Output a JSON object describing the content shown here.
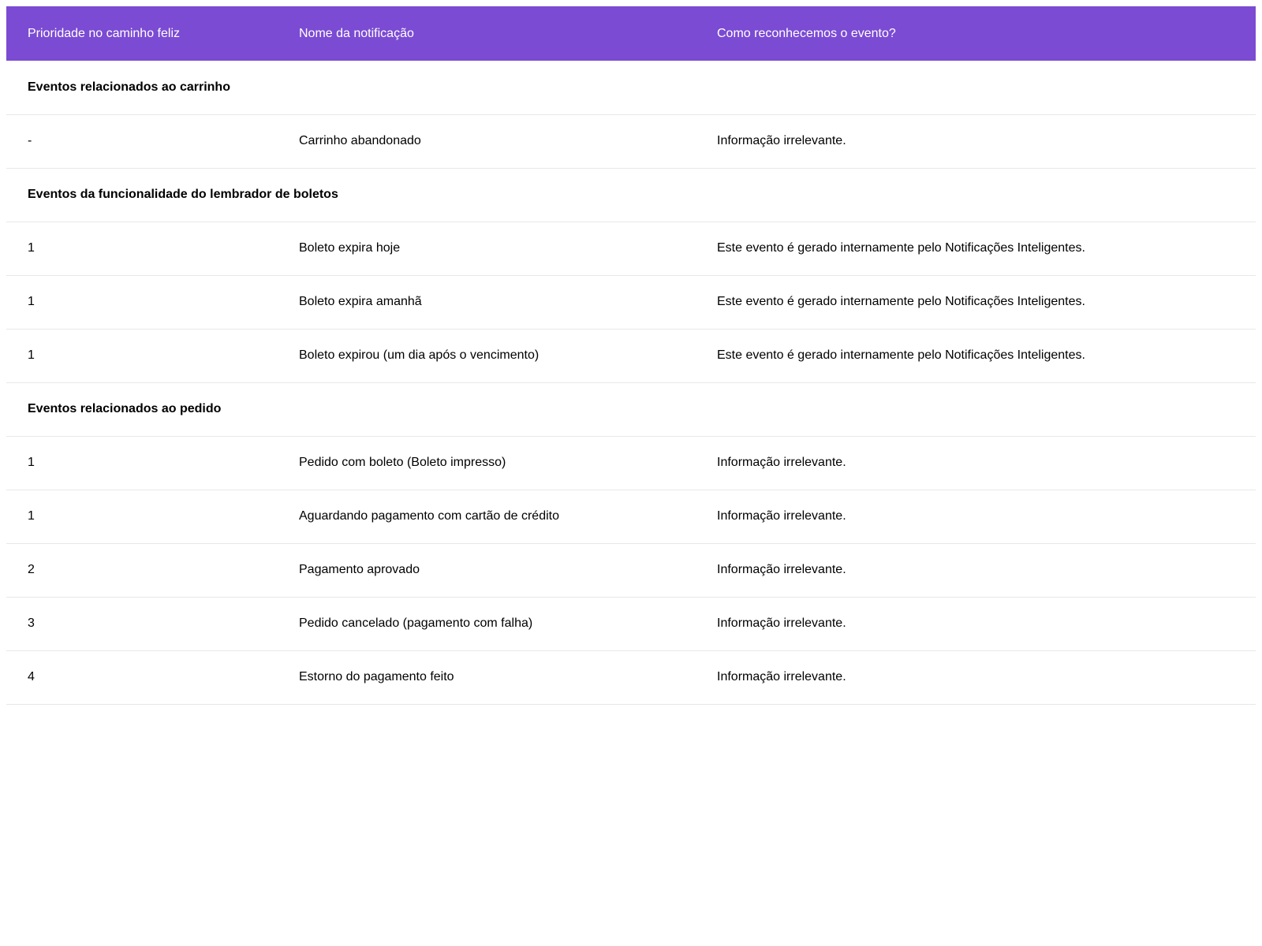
{
  "header": {
    "col_priority": "Prioridade no caminho feliz",
    "col_name": "Nome da notificação",
    "col_recognition": "Como reconhecemos o evento?"
  },
  "groups": [
    {
      "title": "Eventos relacionados ao carrinho",
      "rows": [
        {
          "priority": "-",
          "name": "Carrinho abandonado",
          "recognition": "Informação irrelevante."
        }
      ]
    },
    {
      "title": "Eventos da funcionalidade do lembrador de boletos",
      "rows": [
        {
          "priority": "1",
          "name": "Boleto expira hoje",
          "recognition": "Este evento é gerado internamente pelo Notificações Inteligentes."
        },
        {
          "priority": "1",
          "name": "Boleto expira amanhã",
          "recognition": "Este evento é gerado internamente pelo Notificações Inteligentes."
        },
        {
          "priority": "1",
          "name": "Boleto expirou (um dia após o vencimento)",
          "recognition": "Este evento é gerado internamente pelo Notificações Inteligentes."
        }
      ]
    },
    {
      "title": "Eventos relacionados ao pedido",
      "rows": [
        {
          "priority": "1",
          "name": "Pedido com boleto (Boleto impresso)",
          "recognition": "Informação irrelevante."
        },
        {
          "priority": "1",
          "name": "Aguardando pagamento com cartão de crédito",
          "recognition": "Informação irrelevante."
        },
        {
          "priority": "2",
          "name": "Pagamento aprovado",
          "recognition": "Informação irrelevante."
        },
        {
          "priority": "3",
          "name": "Pedido cancelado (pagamento com falha)",
          "recognition": "Informação irrelevante."
        },
        {
          "priority": "4",
          "name": "Estorno do pagamento feito",
          "recognition": "Informação irrelevante."
        }
      ]
    }
  ],
  "colors": {
    "header_bg": "#7b4bd3",
    "header_text": "#ffffff",
    "row_divider": "#e8e8e8"
  }
}
